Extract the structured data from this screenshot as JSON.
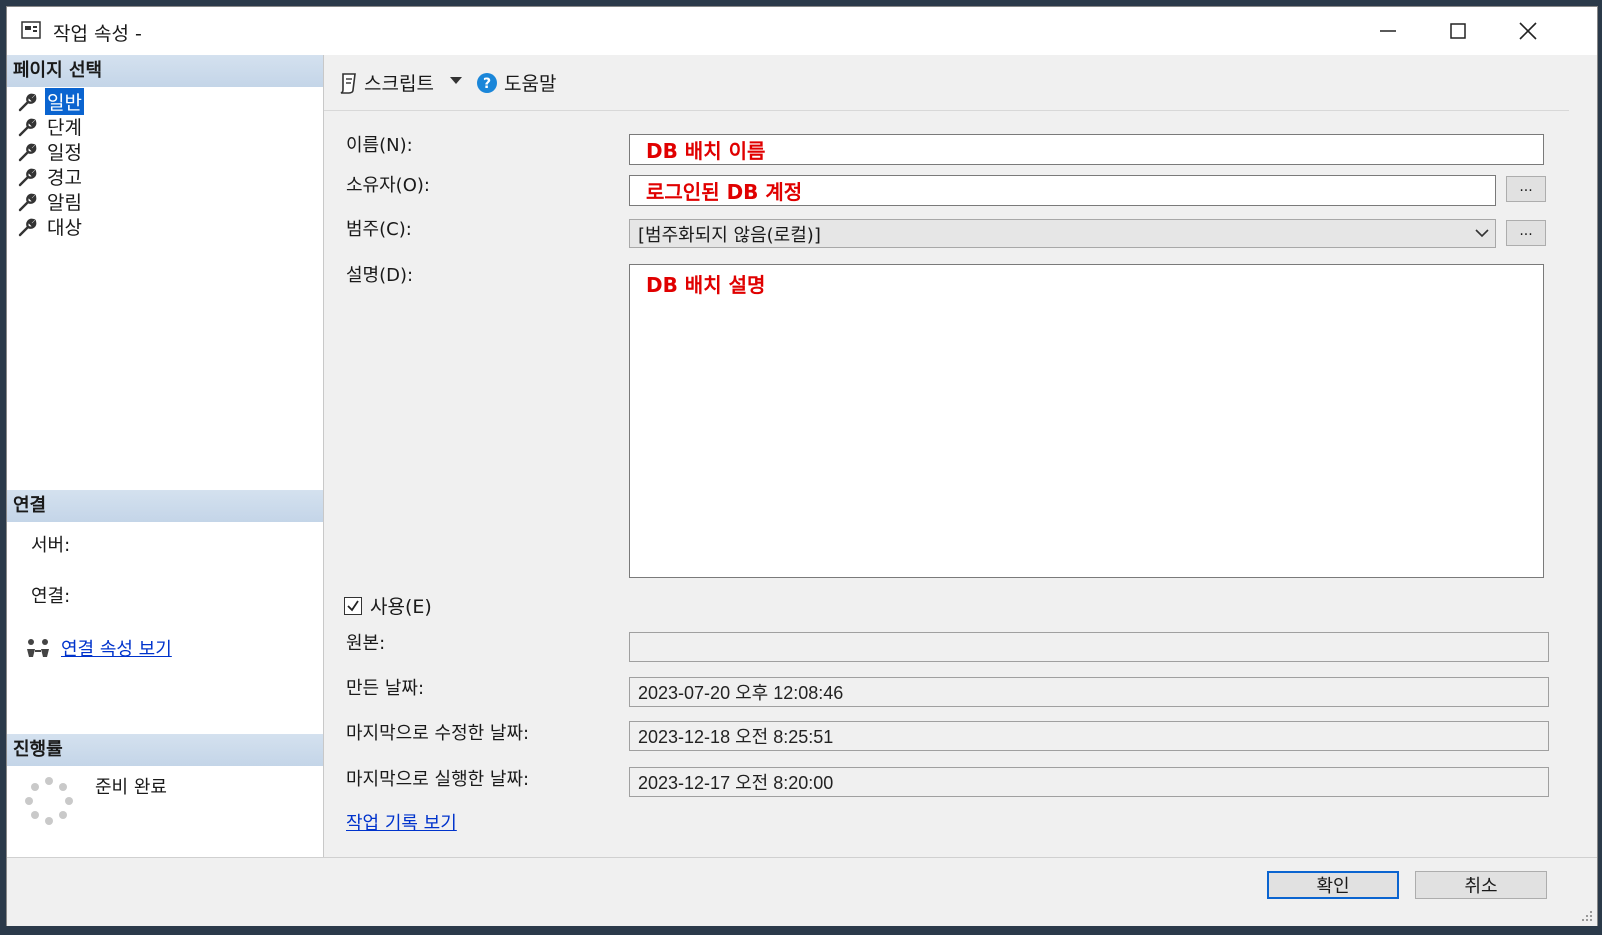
{
  "window": {
    "title": "작업 속성 -"
  },
  "left_panel": {
    "page_select_header": "페이지 선택",
    "pages": [
      {
        "label": "일반",
        "selected": true
      },
      {
        "label": "단계",
        "selected": false
      },
      {
        "label": "일정",
        "selected": false
      },
      {
        "label": "경고",
        "selected": false
      },
      {
        "label": "알림",
        "selected": false
      },
      {
        "label": "대상",
        "selected": false
      }
    ],
    "connection_header": "연결",
    "server_label": "서버:",
    "connection_label": "연결:",
    "view_connection_link": "연결 속성 보기",
    "progress_header": "진행률",
    "progress_status": "준비 완료"
  },
  "toolbar": {
    "script_label": "스크립트",
    "help_label": "도움말"
  },
  "form": {
    "name_label": "이름(N):",
    "name_value": "DB 배치 이름",
    "owner_label": "소유자(O):",
    "owner_value": "로그인된 DB 계정",
    "category_label": "범주(C):",
    "category_value": "[범주화되지 않음(로컬)]",
    "description_label": "설명(D):",
    "description_value": "DB 배치 설명",
    "enabled_label": "사용(E)",
    "enabled_checked": true,
    "source_label": "원본:",
    "source_value": "",
    "created_label": "만든 날짜:",
    "created_value": "2023-07-20 오후 12:08:46",
    "modified_label": "마지막으로 수정한 날짜:",
    "modified_value": "2023-12-18 오전 8:25:51",
    "executed_label": "마지막으로 실행한 날짜:",
    "executed_value": "2023-12-17 오전 8:20:00",
    "history_link": "작업 기록 보기",
    "ellipsis": "..."
  },
  "footer": {
    "ok_label": "확인",
    "cancel_label": "취소"
  },
  "colors": {
    "selection": "#0a64d0",
    "red_text": "#e00000",
    "link": "#0033cc",
    "section_header": "#c4d5e8"
  }
}
